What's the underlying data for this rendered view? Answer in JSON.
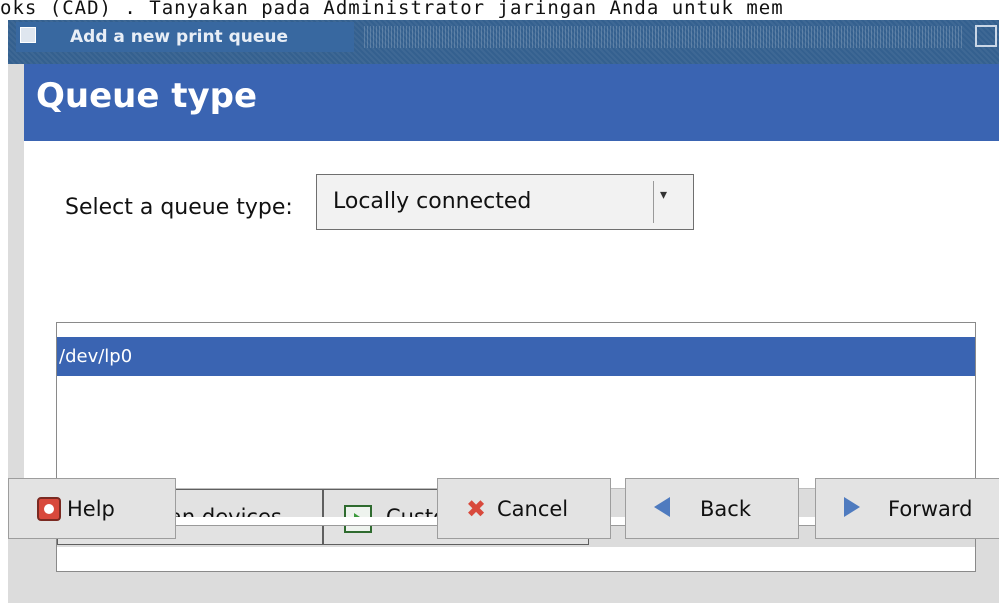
{
  "top_strip": {
    "text": "oks (CAD) . Tanyakan pada Administrator jaringan Anda untuk mem"
  },
  "window": {
    "title": "Add a new print queue",
    "icon": "printer-icon"
  },
  "header": {
    "title": "Queue type"
  },
  "queue_type": {
    "label": "Select a queue type:",
    "selected": "Locally connected",
    "arrow": "▾"
  },
  "device_list": {
    "items": [
      "/dev/lp0"
    ]
  },
  "device_buttons": {
    "rescan": {
      "label": "Rescan devices",
      "icon": "rescan-icon"
    },
    "custom": {
      "label": "Custom device",
      "icon": "custom-device-icon"
    }
  },
  "nav": {
    "help": {
      "label": "Help",
      "icon": "help-icon"
    },
    "cancel": {
      "label": "Cancel",
      "icon": "cancel-icon"
    },
    "back": {
      "label": "Back",
      "icon": "back-arrow-icon"
    },
    "forward": {
      "label": "Forward",
      "icon": "forward-arrow-icon"
    }
  },
  "colors": {
    "header_bg": "#3a64b2",
    "titlebar_bg": "#34608f",
    "selection_bg": "#3a64b2"
  }
}
